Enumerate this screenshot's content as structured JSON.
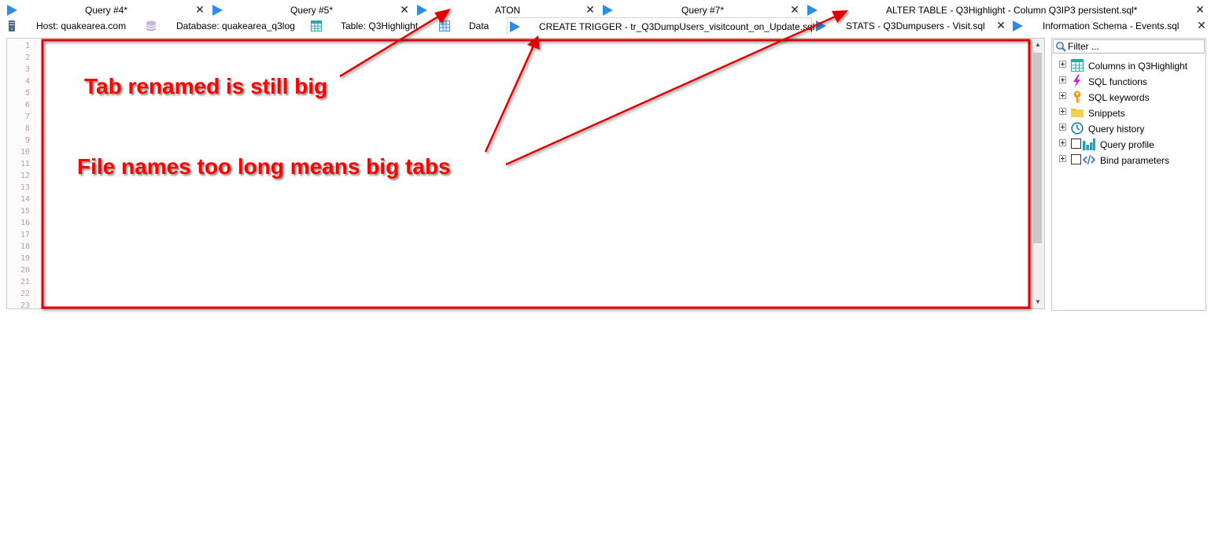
{
  "tabs_row1": [
    {
      "label": "Query #4*",
      "icon": "play-icon",
      "close": "✕"
    },
    {
      "label": "Query #5*",
      "icon": "play-icon",
      "close": "✕"
    },
    {
      "label": "ATON",
      "icon": "play-icon",
      "close": "✕"
    },
    {
      "label": "Query #7*",
      "icon": "play-icon",
      "close": "✕"
    },
    {
      "label": "ALTER TABLE - Q3Highlight - Column Q3IP3 persistent.sql*",
      "icon": "play-icon",
      "close": "✕"
    }
  ],
  "tabs_row2": [
    {
      "label": "Host: quakearea.com",
      "icon": "server-icon"
    },
    {
      "label": "Database: quakearea_q3log",
      "icon": "database-icon"
    },
    {
      "label": "Table: Q3Highlight",
      "icon": "table-icon"
    },
    {
      "label": "Data",
      "icon": "data-grid-icon"
    },
    {
      "label": "CREATE TRIGGER - tr_Q3DumpUsers_visitcount_on_Update.sql",
      "icon": "play-icon",
      "active": true
    },
    {
      "label": "STATS - Q3Dumpusers - Visit.sql",
      "icon": "play-icon",
      "close": "✕"
    },
    {
      "label": "Information Schema - Events.sql",
      "icon": "play-icon",
      "close": "✕"
    }
  ],
  "editor": {
    "line_numbers": [
      "1",
      "2",
      "3",
      "4",
      "5",
      "6",
      "7",
      "8",
      "9",
      "10",
      "11",
      "12",
      "13",
      "14",
      "15",
      "16",
      "17",
      "18",
      "19",
      "20",
      "21",
      "22",
      "23"
    ],
    "scroll_up": "▲",
    "scroll_down": "▼"
  },
  "side_panel": {
    "filter_placeholder": "Filter ...",
    "items": [
      {
        "label": "Columns in Q3Highlight",
        "icon": "table-columns-icon",
        "checkbox": false
      },
      {
        "label": "SQL functions",
        "icon": "lightning-icon",
        "checkbox": false
      },
      {
        "label": "SQL keywords",
        "icon": "key-icon",
        "checkbox": false
      },
      {
        "label": "Snippets",
        "icon": "folder-icon",
        "checkbox": false
      },
      {
        "label": "Query history",
        "icon": "clock-icon",
        "checkbox": false
      },
      {
        "label": "Query profile",
        "icon": "bar-chart-icon",
        "checkbox": true
      },
      {
        "label": "Bind parameters",
        "icon": "code-icon",
        "checkbox": true
      }
    ]
  },
  "annotations": {
    "tab_renamed": "Tab renamed is still big",
    "file_names": "File names too long means big tabs"
  },
  "colors": {
    "annotation": "#ff0000",
    "play": "#2d8ce6"
  }
}
